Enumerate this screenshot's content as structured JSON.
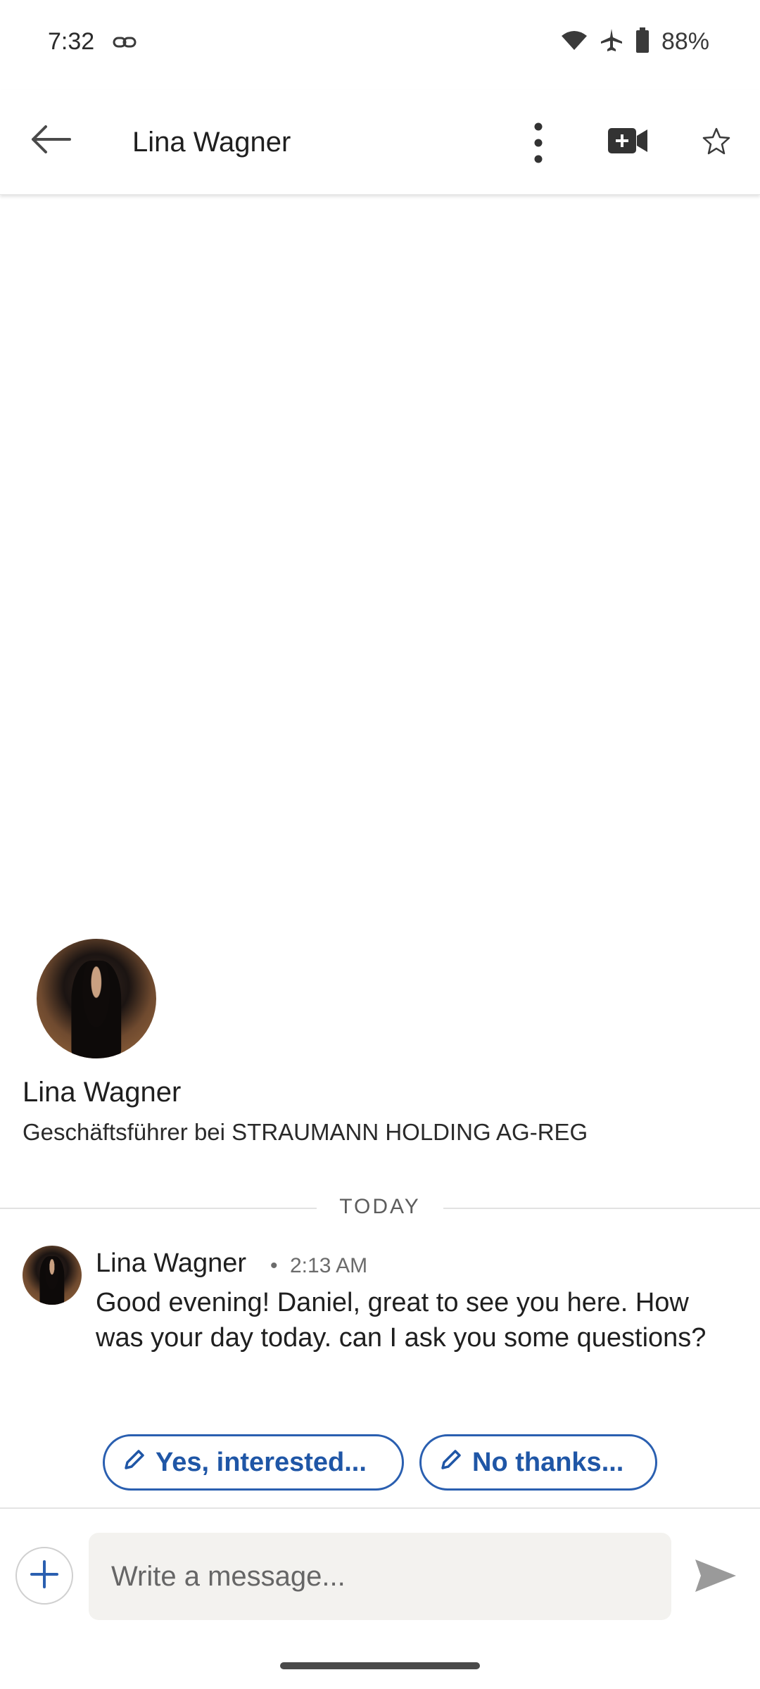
{
  "status_bar": {
    "time": "7:32",
    "battery": "88%",
    "icons": [
      "link-icon",
      "wifi-icon",
      "airplane-icon",
      "battery-icon"
    ]
  },
  "app_bar": {
    "title": "Lina Wagner",
    "icons": [
      "back-arrow-icon",
      "more-vert-icon",
      "video-add-icon",
      "star-outline-icon"
    ]
  },
  "profile": {
    "name": "Lina Wagner",
    "headline": "Geschäftsführer bei STRAUMANN HOLDING AG-REG"
  },
  "divider": {
    "label": "TODAY"
  },
  "message": {
    "sender": "Lina Wagner",
    "separator": "•",
    "time": "2:13 AM",
    "text": "Good evening! Daniel, great to see you here. How was your day today. can I ask you some questions?"
  },
  "quick_replies": [
    {
      "label": "Yes, interested...",
      "icon": "pencil-icon"
    },
    {
      "label": "No thanks...",
      "icon": "pencil-icon"
    }
  ],
  "composer": {
    "placeholder": "Write a message...",
    "icons": [
      "plus-icon",
      "send-icon"
    ]
  },
  "colors": {
    "accent": "#2a5fb0",
    "divider": "#e2e2e2",
    "input_bg": "#f3f2ef"
  }
}
